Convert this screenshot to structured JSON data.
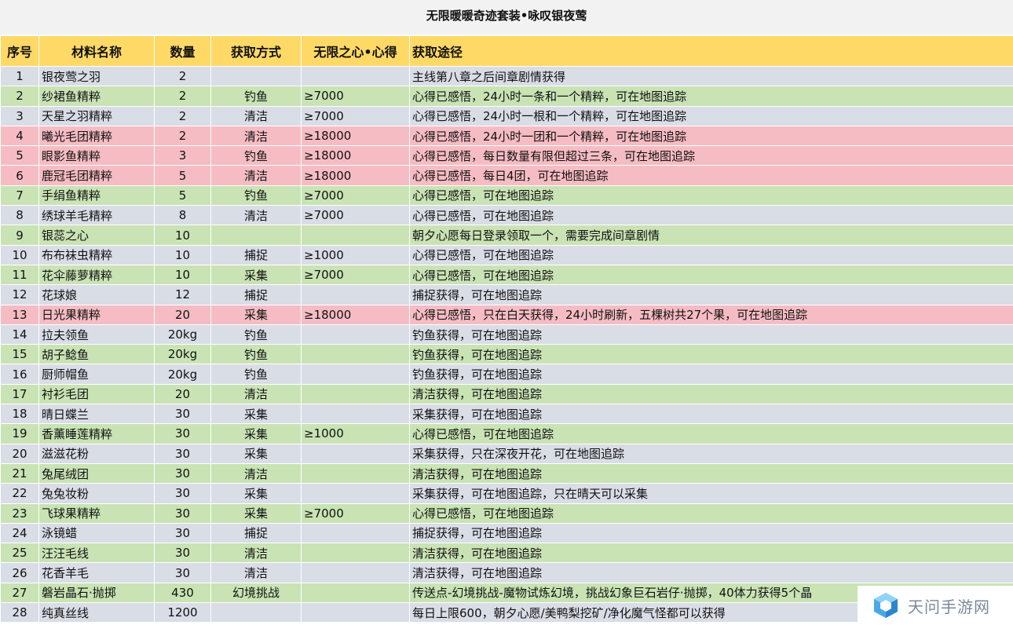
{
  "title": "无限暖暖奇迹套装•咏叹银夜莺",
  "headers": [
    "序号",
    "材料名称",
    "数量",
    "获取方式",
    "无限之心•心得",
    "获取途径"
  ],
  "rows": [
    {
      "no": "1",
      "name": "银夜莺之羽",
      "qty": "2",
      "method": "",
      "req": "",
      "route": "主线第八章之后间章剧情获得",
      "color": "gray"
    },
    {
      "no": "2",
      "name": "纱裙鱼精粹",
      "qty": "2",
      "method": "钓鱼",
      "req": "≥7000",
      "route": "心得已感悟，24小时一条和一个精粹，可在地图追踪",
      "color": "green"
    },
    {
      "no": "3",
      "name": "天星之羽精粹",
      "qty": "2",
      "method": "清洁",
      "req": "≥7000",
      "route": "心得已感悟，24小时一根和一个精粹，可在地图追踪",
      "color": "gray"
    },
    {
      "no": "4",
      "name": "曦光毛团精粹",
      "qty": "2",
      "method": "清洁",
      "req": "≥18000",
      "route": "心得已感悟，24小时一团和一个精粹，可在地图追踪",
      "color": "pink"
    },
    {
      "no": "5",
      "name": "眼影鱼精粹",
      "qty": "3",
      "method": "钓鱼",
      "req": "≥18000",
      "route": "心得已感悟，每日数量有限但超过三条，可在地图追踪",
      "color": "pink"
    },
    {
      "no": "6",
      "name": "鹿冠毛团精粹",
      "qty": "5",
      "method": "清洁",
      "req": "≥18000",
      "route": "心得已感悟，每日4团，可在地图追踪",
      "color": "pink"
    },
    {
      "no": "7",
      "name": "手绢鱼精粹",
      "qty": "5",
      "method": "钓鱼",
      "req": "≥7000",
      "route": "心得已感悟，可在地图追踪",
      "color": "green"
    },
    {
      "no": "8",
      "name": "绣球羊毛精粹",
      "qty": "8",
      "method": "清洁",
      "req": "≥7000",
      "route": "心得已感悟，可在地图追踪",
      "color": "gray"
    },
    {
      "no": "9",
      "name": "银蕊之心",
      "qty": "10",
      "method": "",
      "req": "",
      "route": "朝夕心愿每日登录领取一个，需要完成间章剧情",
      "color": "green"
    },
    {
      "no": "10",
      "name": "布布袜虫精粹",
      "qty": "10",
      "method": "捕捉",
      "req": "≥1000",
      "route": "心得已感悟，可在地图追踪",
      "color": "gray"
    },
    {
      "no": "11",
      "name": "花伞藤萝精粹",
      "qty": "10",
      "method": "采集",
      "req": "≥7000",
      "route": "心得已感悟，可在地图追踪",
      "color": "green"
    },
    {
      "no": "12",
      "name": "花球娘",
      "qty": "12",
      "method": "捕捉",
      "req": "",
      "route": "捕捉获得，可在地图追踪",
      "color": "gray"
    },
    {
      "no": "13",
      "name": "日光果精粹",
      "qty": "20",
      "method": "采集",
      "req": "≥18000",
      "route": "心得已感悟，只在白天获得，24小时刷新，五棵树共27个果，可在地图追踪",
      "color": "pink"
    },
    {
      "no": "14",
      "name": "拉夫领鱼",
      "qty": "20kg",
      "method": "钓鱼",
      "req": "",
      "route": "钓鱼获得，可在地图追踪",
      "color": "gray"
    },
    {
      "no": "15",
      "name": "胡子鲶鱼",
      "qty": "20kg",
      "method": "钓鱼",
      "req": "",
      "route": "钓鱼获得，可在地图追踪",
      "color": "green"
    },
    {
      "no": "16",
      "name": "厨师帽鱼",
      "qty": "20kg",
      "method": "钓鱼",
      "req": "",
      "route": "钓鱼获得，可在地图追踪",
      "color": "gray"
    },
    {
      "no": "17",
      "name": "衬衫毛团",
      "qty": "20",
      "method": "清洁",
      "req": "",
      "route": "清洁获得，可在地图追踪",
      "color": "green"
    },
    {
      "no": "18",
      "name": "晴日蝶兰",
      "qty": "30",
      "method": "采集",
      "req": "",
      "route": "采集获得，可在地图追踪",
      "color": "gray"
    },
    {
      "no": "19",
      "name": "香薰睡莲精粹",
      "qty": "30",
      "method": "采集",
      "req": "≥1000",
      "route": "心得已感悟，可在地图追踪",
      "color": "green"
    },
    {
      "no": "20",
      "name": "滋滋花粉",
      "qty": "30",
      "method": "采集",
      "req": "",
      "route": "采集获得，只在深夜开花，可在地图追踪",
      "color": "gray"
    },
    {
      "no": "21",
      "name": "兔尾绒团",
      "qty": "30",
      "method": "清洁",
      "req": "",
      "route": "清洁获得，可在地图追踪",
      "color": "green"
    },
    {
      "no": "22",
      "name": "兔兔妆粉",
      "qty": "30",
      "method": "采集",
      "req": "",
      "route": "采集获得，可在地图追踪，只在晴天可以采集",
      "color": "gray"
    },
    {
      "no": "23",
      "name": "飞球果精粹",
      "qty": "30",
      "method": "采集",
      "req": "≥7000",
      "route": "心得已感悟，可在地图追踪",
      "color": "green"
    },
    {
      "no": "24",
      "name": "泳镜蜡",
      "qty": "30",
      "method": "捕捉",
      "req": "",
      "route": "捕捉获得，可在地图追踪",
      "color": "gray"
    },
    {
      "no": "25",
      "name": "汪汪毛线",
      "qty": "30",
      "method": "清洁",
      "req": "",
      "route": "清洁获得，可在地图追踪",
      "color": "green"
    },
    {
      "no": "26",
      "name": "花香羊毛",
      "qty": "30",
      "method": "清洁",
      "req": "",
      "route": "清洁获得，可在地图追踪",
      "color": "gray"
    },
    {
      "no": "27",
      "name": "磐岩晶石·抛掷",
      "qty": "430",
      "method": "幻境挑战",
      "req": "",
      "route": "传送点-幻境挑战-魔物试炼幻境，挑战幻象巨石岩仔·抛掷，40体力获得5个晶",
      "color": "green"
    },
    {
      "no": "28",
      "name": "纯真丝线",
      "qty": "1200",
      "method": "",
      "req": "",
      "route": "每日上限600，朝夕心愿/美鸭梨挖矿/净化魔气怪都可以获得",
      "color": "gray"
    }
  ],
  "watermark": {
    "text": "天问手游网",
    "icon": "cube-logo-icon"
  }
}
